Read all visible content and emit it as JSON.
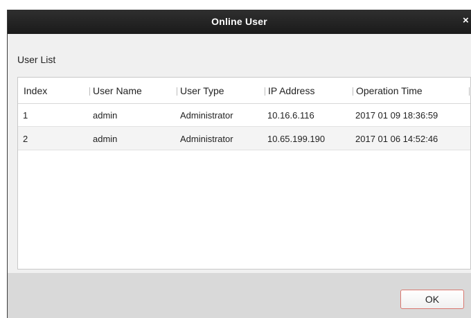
{
  "window": {
    "title": "Online User",
    "close_glyph": "×"
  },
  "section": {
    "label": "User List"
  },
  "table": {
    "columns": [
      "Index",
      "User Name",
      "User Type",
      "IP Address",
      "Operation Time"
    ],
    "rows": [
      [
        "1",
        "admin",
        "Administrator",
        "10.16.6.116",
        "2017 01 09 18:36:59"
      ],
      [
        "2",
        "admin",
        "Administrator",
        "10.65.199.190",
        "2017 01 06 14:52:46"
      ]
    ]
  },
  "footer": {
    "ok_label": "OK"
  },
  "colors": {
    "titlebar": "#1f1f1f",
    "ok_border": "#d9776f",
    "footer_bg": "#d9d9d9"
  }
}
